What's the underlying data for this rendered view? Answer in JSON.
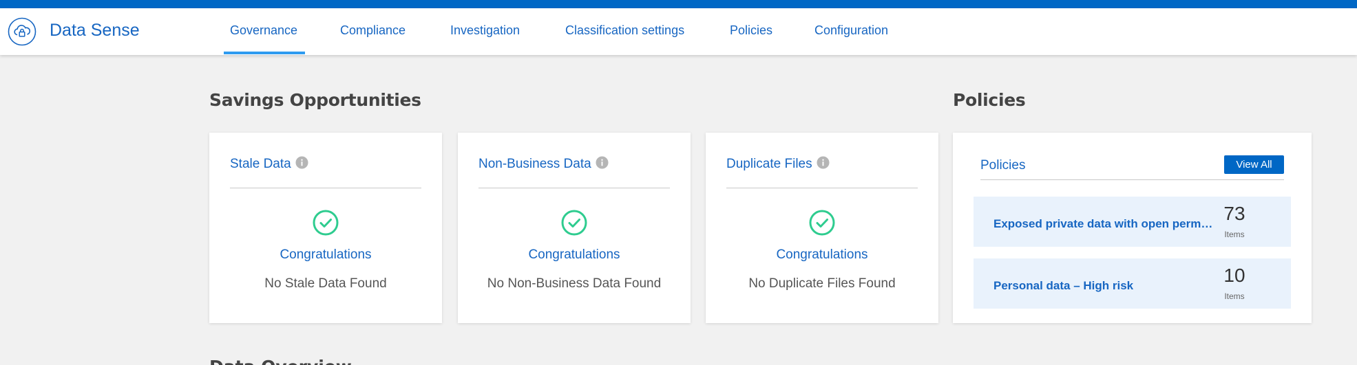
{
  "header": {
    "app_title": "Data Sense",
    "logo_icon": "cloud-lock-icon",
    "tabs": [
      {
        "label": "Governance",
        "active": true
      },
      {
        "label": "Compliance"
      },
      {
        "label": "Investigation"
      },
      {
        "label": "Classification settings"
      },
      {
        "label": "Policies"
      },
      {
        "label": "Configuration"
      }
    ]
  },
  "savings": {
    "title": "Savings Opportunities",
    "cards": [
      {
        "title": "Stale Data",
        "status_title": "Congratulations",
        "status_text": "No Stale Data Found"
      },
      {
        "title": "Non-Business Data",
        "status_title": "Congratulations",
        "status_text": "No Non-Business Data Found"
      },
      {
        "title": "Duplicate Files",
        "status_title": "Congratulations",
        "status_text": "No Duplicate Files Found"
      }
    ]
  },
  "policies": {
    "title": "Policies",
    "card_title": "Policies",
    "view_all_label": "View All",
    "items": [
      {
        "name": "Exposed private data with open permi...",
        "count": "73",
        "unit": "Items"
      },
      {
        "name": "Personal data – High risk",
        "count": "10",
        "unit": "Items"
      }
    ]
  },
  "next_section": {
    "title": "Data Overview"
  },
  "colors": {
    "accent": "#0067c5",
    "link": "#1766c2",
    "success": "#2ecc8f",
    "info": "#b5b5b5"
  }
}
